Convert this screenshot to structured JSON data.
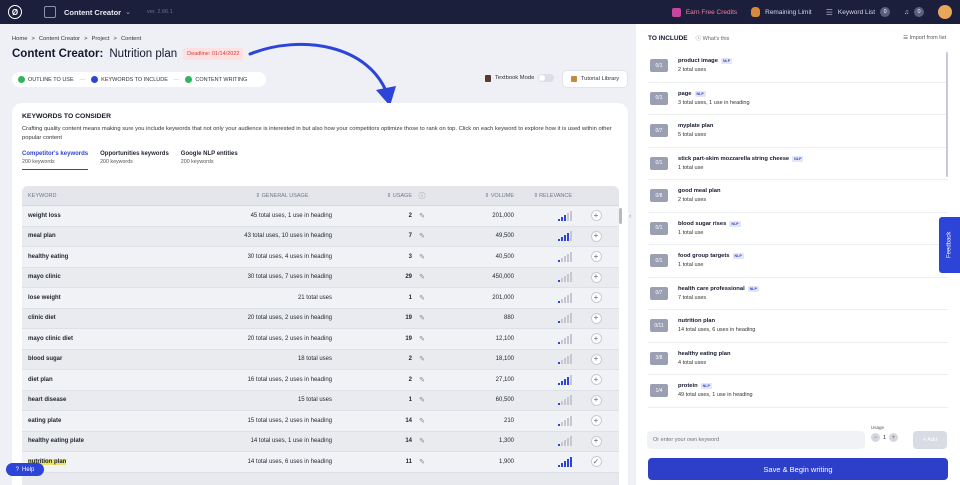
{
  "topbar": {
    "logo": "Ø",
    "app_name": "Content Creator",
    "version": "ver. 2.66.1",
    "earn_credits": "Earn Free Credits",
    "remaining_limit": "Remaining Limit",
    "keyword_list": "Keyword List",
    "keyword_list_count": "0",
    "notif_count": "0"
  },
  "breadcrumb": [
    "Home",
    "Content Creator",
    "Project",
    "Content"
  ],
  "breadcrumb_sep": ">",
  "title": {
    "bold": "Content Creator:",
    "light": "Nutrition plan",
    "deadline": "Deadline: 01/14/2022"
  },
  "steps": [
    "OUTLINE TO USE",
    "KEYWORDS TO INCLUDE",
    "CONTENT WRITING"
  ],
  "textbook_mode": "Textbook Mode",
  "tutorial_library": "Tutorial Library",
  "keywords": {
    "heading": "KEYWORDS TO CONSIDER",
    "description": "Crafting quality content means making sure you include keywords that not only your audience is interested in but also how your competitors optimize those to rank on top. Click on each keyword to explore how it is used within other popular content",
    "tabs": [
      {
        "label": "Competitor's keywords",
        "count": "200 keywords"
      },
      {
        "label": "Opportunities keywords",
        "count": "200 keywords"
      },
      {
        "label": "Google NLP entities",
        "count": "200 keywords"
      }
    ],
    "columns": {
      "keyword": "KEYWORD",
      "general_usage": "GENERAL USAGE",
      "usage": "USAGE",
      "volume": "VOLUME",
      "relevance": "RELEVANCE"
    },
    "rows": [
      {
        "keyword": "weight loss",
        "general": "45 total uses, 1 use in heading",
        "usage": "2",
        "volume": "201,000",
        "relevance": 3
      },
      {
        "keyword": "meal plan",
        "general": "43 total uses, 10 uses in heading",
        "usage": "7",
        "volume": "49,500",
        "relevance": 4
      },
      {
        "keyword": "healthy eating",
        "general": "30 total uses, 4 uses in heading",
        "usage": "3",
        "volume": "40,500",
        "relevance": 1
      },
      {
        "keyword": "mayo clinic",
        "general": "30 total uses, 7 uses in heading",
        "usage": "29",
        "volume": "450,000",
        "relevance": 1
      },
      {
        "keyword": "lose weight",
        "general": "21 total uses",
        "usage": "1",
        "volume": "201,000",
        "relevance": 1
      },
      {
        "keyword": "clinic diet",
        "general": "20 total uses, 2 uses in heading",
        "usage": "19",
        "volume": "880",
        "relevance": 1
      },
      {
        "keyword": "mayo clinic diet",
        "general": "20 total uses, 2 uses in heading",
        "usage": "19",
        "volume": "12,100",
        "relevance": 1
      },
      {
        "keyword": "blood sugar",
        "general": "18 total uses",
        "usage": "2",
        "volume": "18,100",
        "relevance": 1
      },
      {
        "keyword": "diet plan",
        "general": "16 total uses, 2 uses in heading",
        "usage": "2",
        "volume": "27,100",
        "relevance": 4
      },
      {
        "keyword": "heart disease",
        "general": "15 total uses",
        "usage": "1",
        "volume": "60,500",
        "relevance": 1
      },
      {
        "keyword": "eating plate",
        "general": "15 total uses, 2 uses in heading",
        "usage": "14",
        "volume": "210",
        "relevance": 1
      },
      {
        "keyword": "healthy eating plate",
        "general": "14 total uses, 1 use in heading",
        "usage": "14",
        "volume": "1,300",
        "relevance": 1
      },
      {
        "keyword": "nutrition plan",
        "general": "14 total uses, 6 uses in heading",
        "usage": "11",
        "volume": "1,900",
        "relevance": 5
      }
    ]
  },
  "help": "Help",
  "include": {
    "title": "TO INCLUDE",
    "whats_this": "What's this",
    "import": "Import from list",
    "nlp_label": "NLP",
    "items": [
      {
        "badge": "0/1",
        "name": "product image",
        "nlp": true,
        "sub": "2 total uses"
      },
      {
        "badge": "0/1",
        "name": "page",
        "nlp": true,
        "sub": "3 total uses, 1 use in heading"
      },
      {
        "badge": "0/7",
        "name": "myplate plan",
        "nlp": false,
        "sub": "5 total uses"
      },
      {
        "badge": "0/1",
        "name": "stick part-skim mozzarella string cheese",
        "nlp": true,
        "sub": "1 total use"
      },
      {
        "badge": "0/8",
        "name": "good meal plan",
        "nlp": false,
        "sub": "2 total uses"
      },
      {
        "badge": "0/1",
        "name": "blood sugar rises",
        "nlp": true,
        "sub": "1 total use"
      },
      {
        "badge": "0/1",
        "name": "food group targets",
        "nlp": true,
        "sub": "1 total use"
      },
      {
        "badge": "0/7",
        "name": "health care professional",
        "nlp": true,
        "sub": "7 total uses"
      },
      {
        "badge": "0/11",
        "name": "nutrition plan",
        "nlp": false,
        "sub": "14 total uses, 6 uses in heading"
      },
      {
        "badge": "3/8",
        "name": "healthy eating plan",
        "nlp": false,
        "sub": "4 total uses"
      },
      {
        "badge": "1/4",
        "name": "protein",
        "nlp": true,
        "sub": "49 total uses, 1 use in heading"
      }
    ],
    "usage_label": "Usage",
    "own_keyword_placeholder": "Or enter your own keyword",
    "stepper_value": "1",
    "add_label": "+ Add",
    "save_button": "Save & Begin writing"
  },
  "feedback": "Feedback",
  "colors": {
    "accent": "#2d44d8",
    "topbar": "#1b1f3b",
    "deadline": "#d23c3c"
  }
}
